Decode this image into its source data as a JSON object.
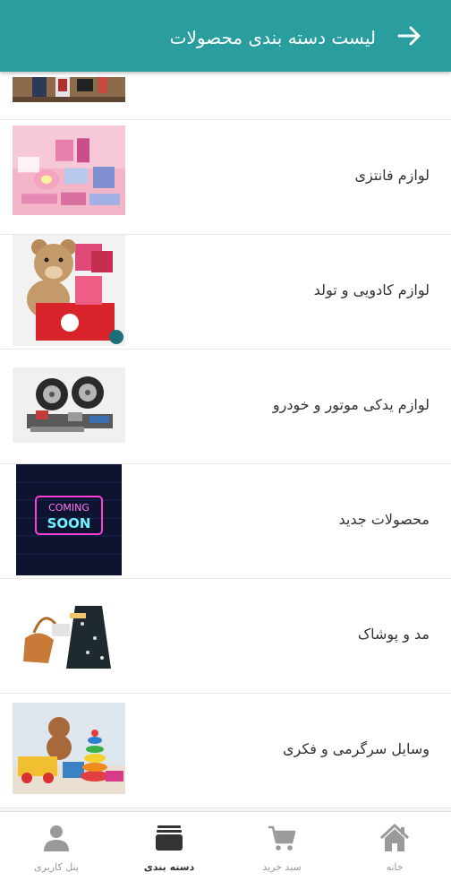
{
  "header": {
    "title": "لیست دسته بندی محصولات",
    "back_icon": "arrow-right-icon",
    "background_color": "#2a9d9f"
  },
  "categories": [
    {
      "label": "",
      "image": "partial-gadgets-image"
    },
    {
      "label": "لوازم فانتزی",
      "image": "fancy-accessories-image"
    },
    {
      "label": "لوازم کادویی و تولد",
      "image": "teddy-bear-gift-image"
    },
    {
      "label": "لوازم یدکی موتور و خودرو",
      "image": "auto-parts-image"
    },
    {
      "label": "محصولات جدید",
      "image": "coming-soon-neon-image"
    },
    {
      "label": "مد و پوشاک",
      "image": "fashion-clothing-image"
    },
    {
      "label": "وسایل سرگرمی و فکری",
      "image": "toys-image"
    }
  ],
  "bottom_nav": [
    {
      "label": "خانه",
      "icon": "home-icon",
      "active": false
    },
    {
      "label": "سبد خرید",
      "icon": "cart-icon",
      "active": false
    },
    {
      "label": "دسته بندی",
      "icon": "category-box-icon",
      "active": true
    },
    {
      "label": "پنل کاربری",
      "icon": "user-icon",
      "active": false
    }
  ]
}
